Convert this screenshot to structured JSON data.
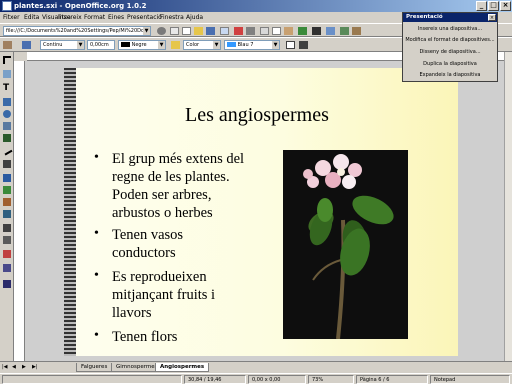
{
  "window": {
    "title": "plantes.sxi - OpenOffice.org 1.0.2"
  },
  "menu": [
    "Fitxer",
    "Edita",
    "Visualitza",
    "Insereix",
    "Format",
    "Eines",
    "Presentació",
    "Finestra",
    "Ajuda"
  ],
  "toolbar": {
    "url": "file:///C:/Documents%20and%20Settings/Pep/Mi%20Do",
    "line_style": "Continu",
    "line_width": "0,00cm",
    "line_color": "Negre",
    "fill_type": "Color",
    "fill_color": "Blau 7"
  },
  "slide": {
    "title": "Les angiospermes",
    "bullets": [
      [
        "El grup més extens del",
        "regne de les plantes.",
        "Poden ser arbres,",
        "arbustos o herbes"
      ],
      [
        "Tenen vasos",
        "conductors"
      ],
      [
        "Es reprodueixen",
        "mitjançant fruits i",
        "llavors"
      ],
      [
        "Tenen flors"
      ]
    ]
  },
  "tabs": [
    "Falgueres",
    "Gimnospermes",
    "Angiospermes"
  ],
  "active_tab": "Angiospermes",
  "status": {
    "position": "30,84 / 19,46",
    "size": "0,00 x 0,00",
    "zoom": "73%",
    "page": "Pàgina 6 / 6",
    "layout": "Notepad"
  },
  "panel": {
    "title": "Presentació",
    "items": [
      "Insereix una diapositiva...",
      "Modifica el format de diapositives...",
      "Disseny de diapositiva...",
      "Duplica la diapositiva",
      "Expandeix la diapositiva"
    ]
  }
}
